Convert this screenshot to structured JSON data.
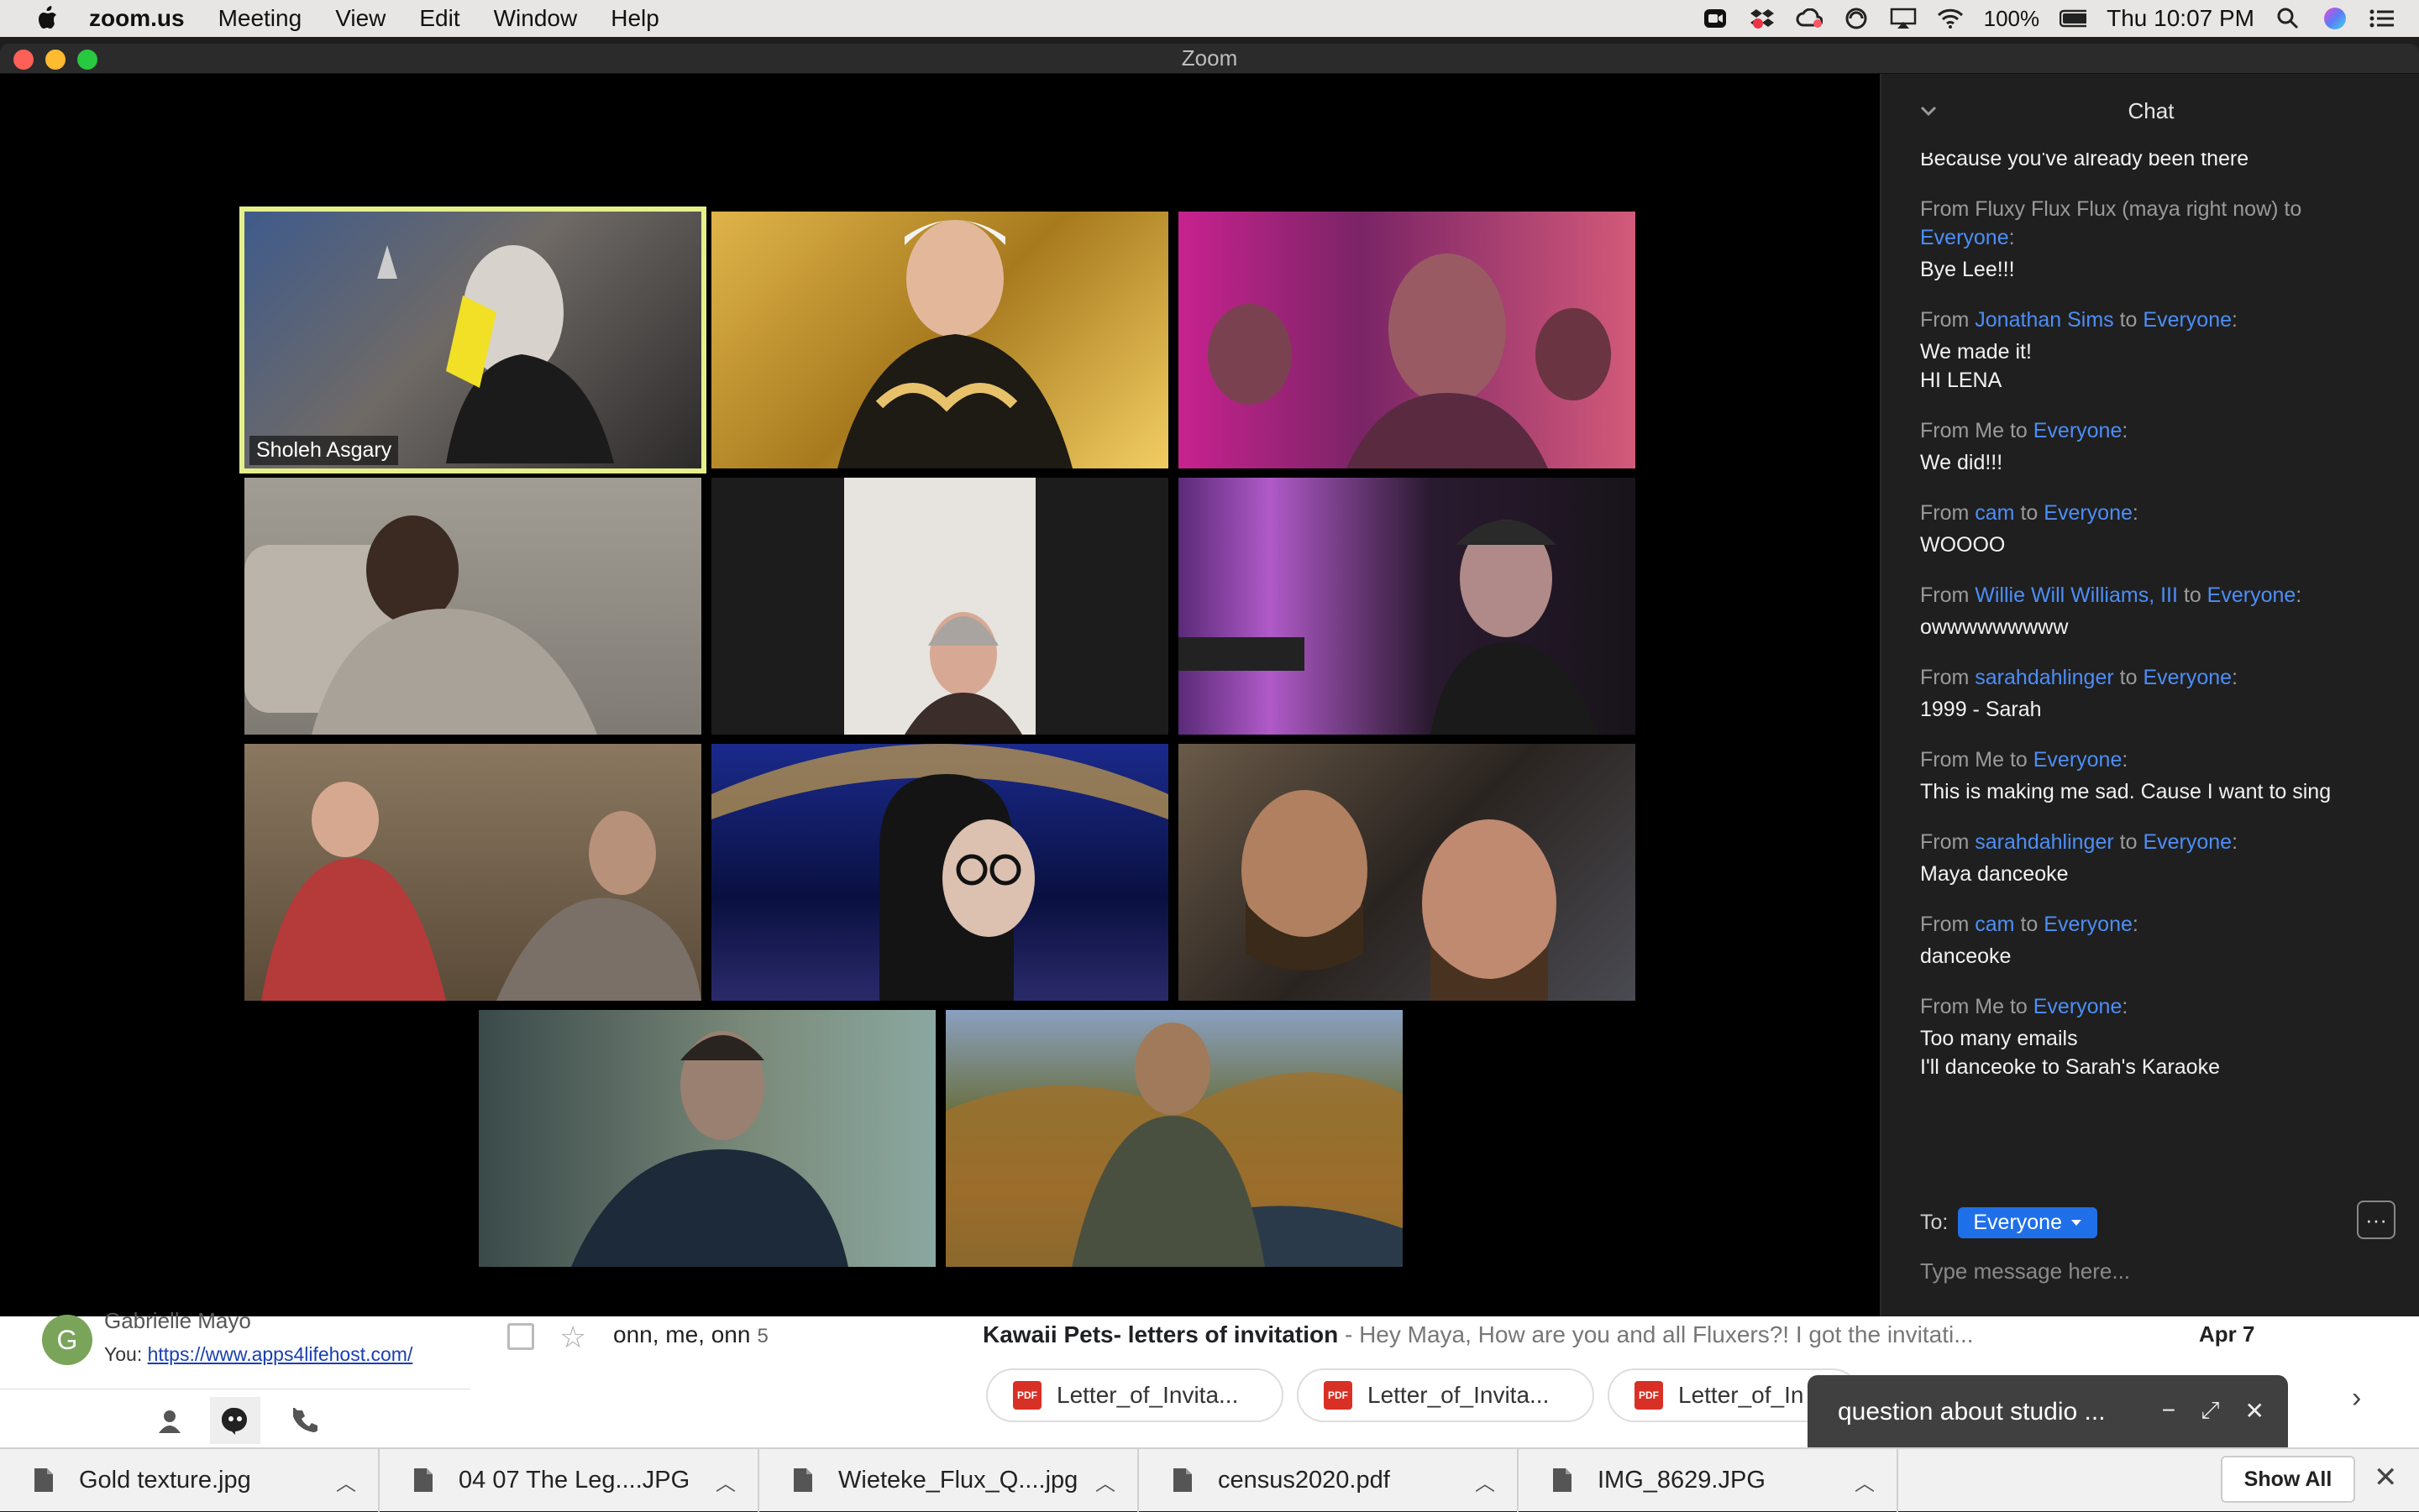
{
  "menubar": {
    "app": "zoom.us",
    "items": [
      "Meeting",
      "View",
      "Edit",
      "Window",
      "Help"
    ],
    "battery": "100%",
    "clock": "Thu 10:07 PM"
  },
  "window": {
    "title": "Zoom"
  },
  "gallery": {
    "active_speaker": "Sholeh Asgary",
    "tiles": [
      {
        "bg": "#4d4a48"
      },
      {
        "bg": "#b88a2a"
      },
      {
        "bg": "#a02a8a"
      },
      {
        "bg": "#8d8880"
      },
      {
        "bg": "#2a2a2a"
      },
      {
        "bg": "#4a2a5a"
      },
      {
        "bg": "#6a5040"
      },
      {
        "bg": "#1a1a55"
      },
      {
        "bg": "#4a3a30"
      },
      {
        "bg": "#3a4a48"
      },
      {
        "bg": "#5a6040"
      }
    ]
  },
  "chat": {
    "title": "Chat",
    "messages": [
      {
        "pre": "",
        "sender": "",
        "mid": "",
        "recipient": "",
        "post": "",
        "lines": [
          "Because you've already been there"
        ]
      },
      {
        "pre": "From Fluxy Flux Flux (maya right now) to ",
        "sender": "",
        "mid": "",
        "recipient": "Everyone",
        "post": ":",
        "lines": [
          "Bye Lee!!!"
        ]
      },
      {
        "pre": "From ",
        "sender": "Jonathan Sims",
        "mid": " to ",
        "recipient": "Everyone",
        "post": ":",
        "lines": [
          "We made it!",
          "HI LENA"
        ]
      },
      {
        "pre": "From Me to ",
        "sender": "",
        "mid": "",
        "recipient": "Everyone",
        "post": ":",
        "lines": [
          "We did!!!"
        ]
      },
      {
        "pre": "From ",
        "sender": "cam",
        "mid": " to ",
        "recipient": "Everyone",
        "post": ":",
        "lines": [
          "WOOOO"
        ]
      },
      {
        "pre": "From ",
        "sender": "Willie Will Williams, III",
        "mid": " to ",
        "recipient": "Everyone",
        "post": ":",
        "lines": [
          "owwwwwwwww"
        ]
      },
      {
        "pre": "From ",
        "sender": "sarahdahlinger",
        "mid": " to ",
        "recipient": "Everyone",
        "post": ":",
        "lines": [
          "1999 - Sarah"
        ]
      },
      {
        "pre": "From Me to ",
        "sender": "",
        "mid": "",
        "recipient": "Everyone",
        "post": ":",
        "lines": [
          "This is making me sad. Cause I want to sing"
        ]
      },
      {
        "pre": "From ",
        "sender": "sarahdahlinger",
        "mid": " to ",
        "recipient": "Everyone",
        "post": ":",
        "lines": [
          "Maya danceoke"
        ]
      },
      {
        "pre": "From ",
        "sender": "cam",
        "mid": " to ",
        "recipient": "Everyone",
        "post": ":",
        "lines": [
          "danceoke"
        ]
      },
      {
        "pre": "From Me to ",
        "sender": "",
        "mid": "",
        "recipient": "Everyone",
        "post": ":",
        "lines": [
          "Too many emails",
          "I'll danceoke to Sarah's Karaoke"
        ]
      }
    ],
    "to_label": "To:",
    "to_value": "Everyone",
    "more": "···",
    "input_placeholder": "Type message here..."
  },
  "gmail": {
    "avatar_letter": "G",
    "contact_name": "Gabrielle Mayo",
    "you_label": "You:",
    "you_link": "https://www.apps4lifehost.com/",
    "senders": "onn, me, onn",
    "sender_count": "5",
    "subject": "Kawaii Pets- letters of invitation",
    "snippet": " - Hey Maya, How are you and all Fluxers?! I got the invitati...",
    "date": "Apr 7",
    "attachments": [
      "Letter_of_Invita...",
      "Letter_of_Invita...",
      "Letter_of_In"
    ],
    "popup_title": "question about studio ..."
  },
  "downloads": {
    "files": [
      "Gold texture.jpg",
      "04 07 The Leg....JPG",
      "Wieteke_Flux_Q....jpg",
      "census2020.pdf",
      "IMG_8629.JPG"
    ],
    "show_all": "Show All"
  }
}
